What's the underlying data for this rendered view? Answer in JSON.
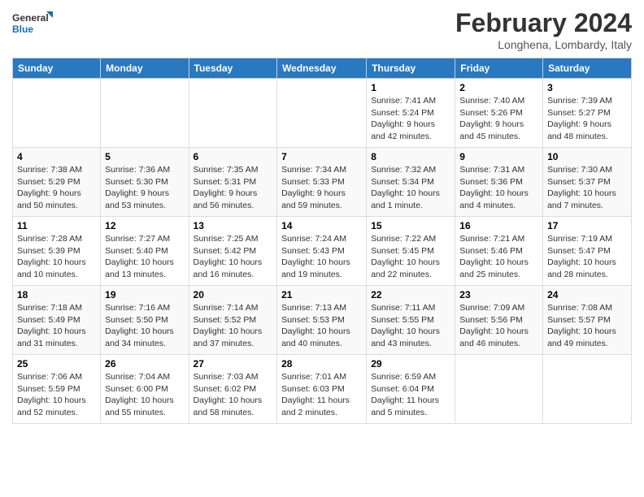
{
  "header": {
    "logo": {
      "general": "General",
      "blue": "Blue"
    },
    "month_title": "February 2024",
    "location": "Longhena, Lombardy, Italy"
  },
  "weekdays": [
    "Sunday",
    "Monday",
    "Tuesday",
    "Wednesday",
    "Thursday",
    "Friday",
    "Saturday"
  ],
  "weeks": [
    [
      {
        "day": "",
        "info": ""
      },
      {
        "day": "",
        "info": ""
      },
      {
        "day": "",
        "info": ""
      },
      {
        "day": "",
        "info": ""
      },
      {
        "day": "1",
        "sunrise": "Sunrise: 7:41 AM",
        "sunset": "Sunset: 5:24 PM",
        "daylight": "Daylight: 9 hours and 42 minutes."
      },
      {
        "day": "2",
        "sunrise": "Sunrise: 7:40 AM",
        "sunset": "Sunset: 5:26 PM",
        "daylight": "Daylight: 9 hours and 45 minutes."
      },
      {
        "day": "3",
        "sunrise": "Sunrise: 7:39 AM",
        "sunset": "Sunset: 5:27 PM",
        "daylight": "Daylight: 9 hours and 48 minutes."
      }
    ],
    [
      {
        "day": "4",
        "sunrise": "Sunrise: 7:38 AM",
        "sunset": "Sunset: 5:29 PM",
        "daylight": "Daylight: 9 hours and 50 minutes."
      },
      {
        "day": "5",
        "sunrise": "Sunrise: 7:36 AM",
        "sunset": "Sunset: 5:30 PM",
        "daylight": "Daylight: 9 hours and 53 minutes."
      },
      {
        "day": "6",
        "sunrise": "Sunrise: 7:35 AM",
        "sunset": "Sunset: 5:31 PM",
        "daylight": "Daylight: 9 hours and 56 minutes."
      },
      {
        "day": "7",
        "sunrise": "Sunrise: 7:34 AM",
        "sunset": "Sunset: 5:33 PM",
        "daylight": "Daylight: 9 hours and 59 minutes."
      },
      {
        "day": "8",
        "sunrise": "Sunrise: 7:32 AM",
        "sunset": "Sunset: 5:34 PM",
        "daylight": "Daylight: 10 hours and 1 minute."
      },
      {
        "day": "9",
        "sunrise": "Sunrise: 7:31 AM",
        "sunset": "Sunset: 5:36 PM",
        "daylight": "Daylight: 10 hours and 4 minutes."
      },
      {
        "day": "10",
        "sunrise": "Sunrise: 7:30 AM",
        "sunset": "Sunset: 5:37 PM",
        "daylight": "Daylight: 10 hours and 7 minutes."
      }
    ],
    [
      {
        "day": "11",
        "sunrise": "Sunrise: 7:28 AM",
        "sunset": "Sunset: 5:39 PM",
        "daylight": "Daylight: 10 hours and 10 minutes."
      },
      {
        "day": "12",
        "sunrise": "Sunrise: 7:27 AM",
        "sunset": "Sunset: 5:40 PM",
        "daylight": "Daylight: 10 hours and 13 minutes."
      },
      {
        "day": "13",
        "sunrise": "Sunrise: 7:25 AM",
        "sunset": "Sunset: 5:42 PM",
        "daylight": "Daylight: 10 hours and 16 minutes."
      },
      {
        "day": "14",
        "sunrise": "Sunrise: 7:24 AM",
        "sunset": "Sunset: 5:43 PM",
        "daylight": "Daylight: 10 hours and 19 minutes."
      },
      {
        "day": "15",
        "sunrise": "Sunrise: 7:22 AM",
        "sunset": "Sunset: 5:45 PM",
        "daylight": "Daylight: 10 hours and 22 minutes."
      },
      {
        "day": "16",
        "sunrise": "Sunrise: 7:21 AM",
        "sunset": "Sunset: 5:46 PM",
        "daylight": "Daylight: 10 hours and 25 minutes."
      },
      {
        "day": "17",
        "sunrise": "Sunrise: 7:19 AM",
        "sunset": "Sunset: 5:47 PM",
        "daylight": "Daylight: 10 hours and 28 minutes."
      }
    ],
    [
      {
        "day": "18",
        "sunrise": "Sunrise: 7:18 AM",
        "sunset": "Sunset: 5:49 PM",
        "daylight": "Daylight: 10 hours and 31 minutes."
      },
      {
        "day": "19",
        "sunrise": "Sunrise: 7:16 AM",
        "sunset": "Sunset: 5:50 PM",
        "daylight": "Daylight: 10 hours and 34 minutes."
      },
      {
        "day": "20",
        "sunrise": "Sunrise: 7:14 AM",
        "sunset": "Sunset: 5:52 PM",
        "daylight": "Daylight: 10 hours and 37 minutes."
      },
      {
        "day": "21",
        "sunrise": "Sunrise: 7:13 AM",
        "sunset": "Sunset: 5:53 PM",
        "daylight": "Daylight: 10 hours and 40 minutes."
      },
      {
        "day": "22",
        "sunrise": "Sunrise: 7:11 AM",
        "sunset": "Sunset: 5:55 PM",
        "daylight": "Daylight: 10 hours and 43 minutes."
      },
      {
        "day": "23",
        "sunrise": "Sunrise: 7:09 AM",
        "sunset": "Sunset: 5:56 PM",
        "daylight": "Daylight: 10 hours and 46 minutes."
      },
      {
        "day": "24",
        "sunrise": "Sunrise: 7:08 AM",
        "sunset": "Sunset: 5:57 PM",
        "daylight": "Daylight: 10 hours and 49 minutes."
      }
    ],
    [
      {
        "day": "25",
        "sunrise": "Sunrise: 7:06 AM",
        "sunset": "Sunset: 5:59 PM",
        "daylight": "Daylight: 10 hours and 52 minutes."
      },
      {
        "day": "26",
        "sunrise": "Sunrise: 7:04 AM",
        "sunset": "Sunset: 6:00 PM",
        "daylight": "Daylight: 10 hours and 55 minutes."
      },
      {
        "day": "27",
        "sunrise": "Sunrise: 7:03 AM",
        "sunset": "Sunset: 6:02 PM",
        "daylight": "Daylight: 10 hours and 58 minutes."
      },
      {
        "day": "28",
        "sunrise": "Sunrise: 7:01 AM",
        "sunset": "Sunset: 6:03 PM",
        "daylight": "Daylight: 11 hours and 2 minutes."
      },
      {
        "day": "29",
        "sunrise": "Sunrise: 6:59 AM",
        "sunset": "Sunset: 6:04 PM",
        "daylight": "Daylight: 11 hours and 5 minutes."
      },
      {
        "day": "",
        "info": ""
      },
      {
        "day": "",
        "info": ""
      }
    ]
  ]
}
